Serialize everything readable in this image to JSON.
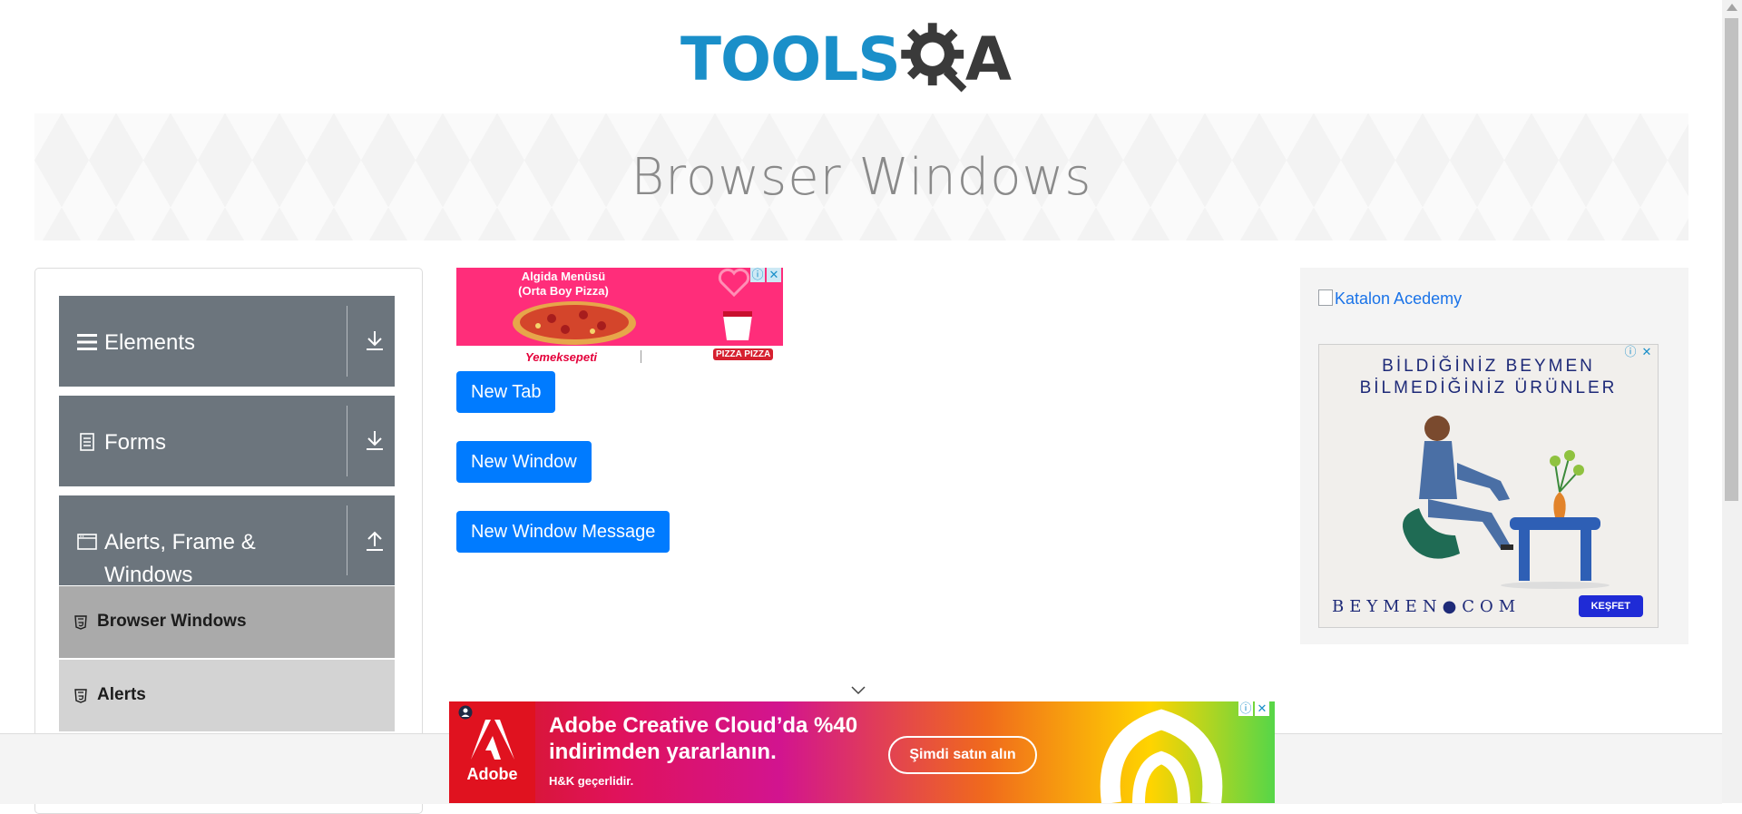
{
  "header": {
    "logo_text_left": "TOOLS",
    "logo_text_right": "A"
  },
  "banner": {
    "title": "Browser Windows"
  },
  "sidebar": {
    "groups": [
      {
        "label": "Elements",
        "icon": "hamburger-icon",
        "arrow": "download-arrow-icon"
      },
      {
        "label": "Forms",
        "icon": "document-icon",
        "arrow": "download-arrow-icon"
      },
      {
        "label": "Alerts, Frame & Windows",
        "icon": "window-icon",
        "arrow": "upload-arrow-icon"
      }
    ],
    "items": [
      {
        "label": "Browser Windows",
        "icon": "html5-icon",
        "active": true
      },
      {
        "label": "Alerts",
        "icon": "html5-icon",
        "active": false
      }
    ]
  },
  "buttons": {
    "new_tab": "New Tab",
    "new_window": "New Window",
    "new_window_message": "New Window Message"
  },
  "ads": {
    "pizza": {
      "title": "Algida Menüsü (Orta Boy Pizza)",
      "brand1": "Yemeksepeti",
      "brand2": "PIZZA PIZZA"
    },
    "katalon_alt": "Katalon Acedemy",
    "beymen": {
      "headline": "BİLDİĞİNİZ BEYMEN BİLMEDİĞİNİZ ÜRÜNLER",
      "logo": "BEYMEN●COM",
      "cta": "KEŞFET"
    },
    "adobe": {
      "logo": "Adobe",
      "line1": "Adobe Creative Cloud’da %40",
      "line2": "indirimden yararlanın.",
      "fine": "H&K geçerlidir.",
      "cta": "Şimdi satın alın"
    }
  },
  "colors": {
    "primary_button": "#007bff",
    "sidebar_group": "#6c757d",
    "active_item": "#aaaaaa",
    "logo_blue": "#1a8fc9"
  }
}
